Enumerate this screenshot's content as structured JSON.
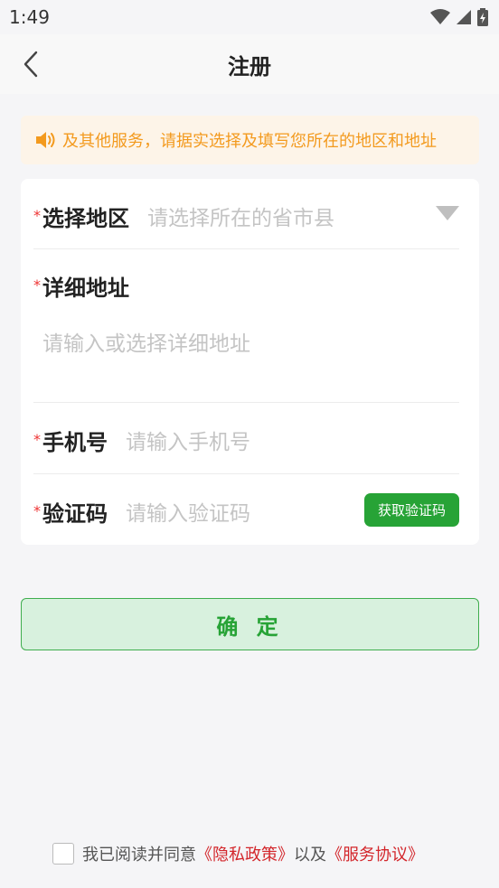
{
  "status_bar": {
    "time": "1:49"
  },
  "nav": {
    "title": "注册"
  },
  "notice": {
    "text": "及其他服务，请据实选择及填写您所在的地区和地址"
  },
  "form": {
    "region": {
      "required": "*",
      "label": "选择地区",
      "placeholder": "请选择所在的省市县"
    },
    "address": {
      "required": "*",
      "label": "详细地址",
      "placeholder": "请输入或选择详细地址"
    },
    "phone": {
      "required": "*",
      "label": "手机号",
      "placeholder": "请输入手机号"
    },
    "code": {
      "required": "*",
      "label": "验证码",
      "placeholder": "请输入验证码",
      "button": "获取验证码"
    }
  },
  "confirm_button": "确 定",
  "agreement": {
    "prefix": "我已阅读并同意",
    "privacy_link": "《隐私政策》",
    "connector": "以及",
    "service_link": "《服务协议》"
  },
  "colors": {
    "accent": "#27a336",
    "notice": "#f39a1e",
    "link": "#d3262b",
    "required": "#e33333"
  }
}
